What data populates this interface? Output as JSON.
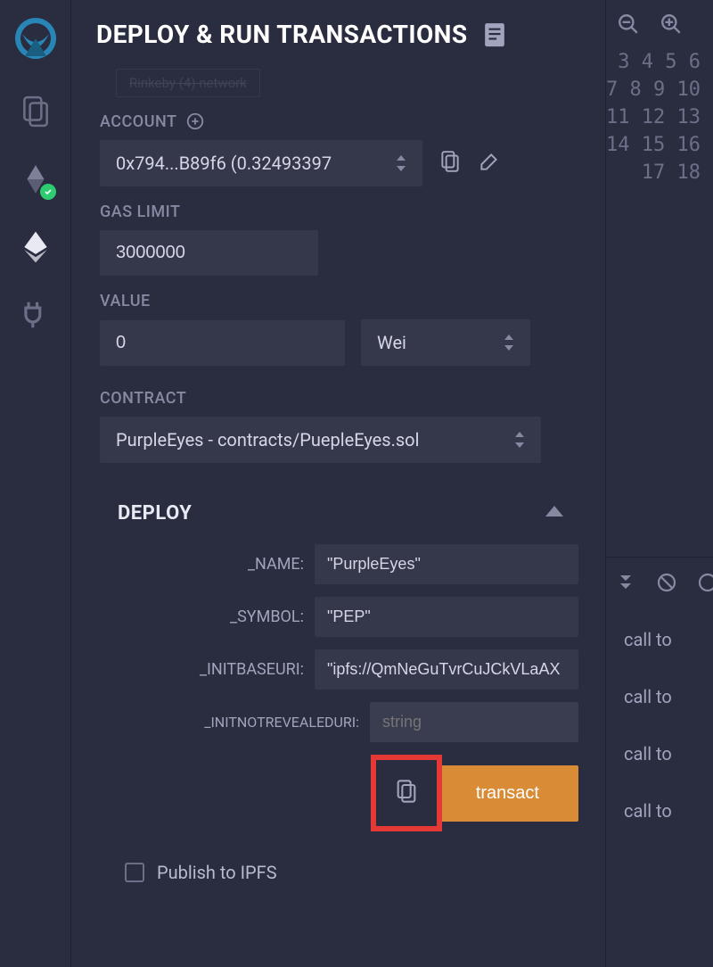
{
  "panel": {
    "title": "DEPLOY & RUN TRANSACTIONS",
    "env_ghost": "Rinkeby (4) network"
  },
  "account": {
    "label": "ACCOUNT",
    "selected": "0x794...B89f6 (0.32493397"
  },
  "gas_limit": {
    "label": "GAS LIMIT",
    "value": "3000000"
  },
  "value": {
    "label": "VALUE",
    "amount": "0",
    "unit": "Wei"
  },
  "contract": {
    "label": "CONTRACT",
    "selected": "PurpleEyes - contracts/PuepleEyes.sol"
  },
  "deploy": {
    "title": "DEPLOY",
    "params": [
      {
        "label": "_NAME:",
        "value": "\"PurpleEyes\""
      },
      {
        "label": "_SYMBOL:",
        "value": "\"PEP\""
      },
      {
        "label": "_INITBASEURI:",
        "value": "\"ipfs://QmNeGuTvrCuJCkVLaAX"
      },
      {
        "label": "_INITNOTREVEALEDURI:",
        "value": "",
        "placeholder": "string"
      }
    ],
    "transact_label": "transact"
  },
  "publish": {
    "label": "Publish to IPFS"
  },
  "editor": {
    "line_start": 3,
    "line_end": 18
  },
  "console": {
    "logs": [
      "call to",
      "call to",
      "call to",
      "call to"
    ]
  }
}
